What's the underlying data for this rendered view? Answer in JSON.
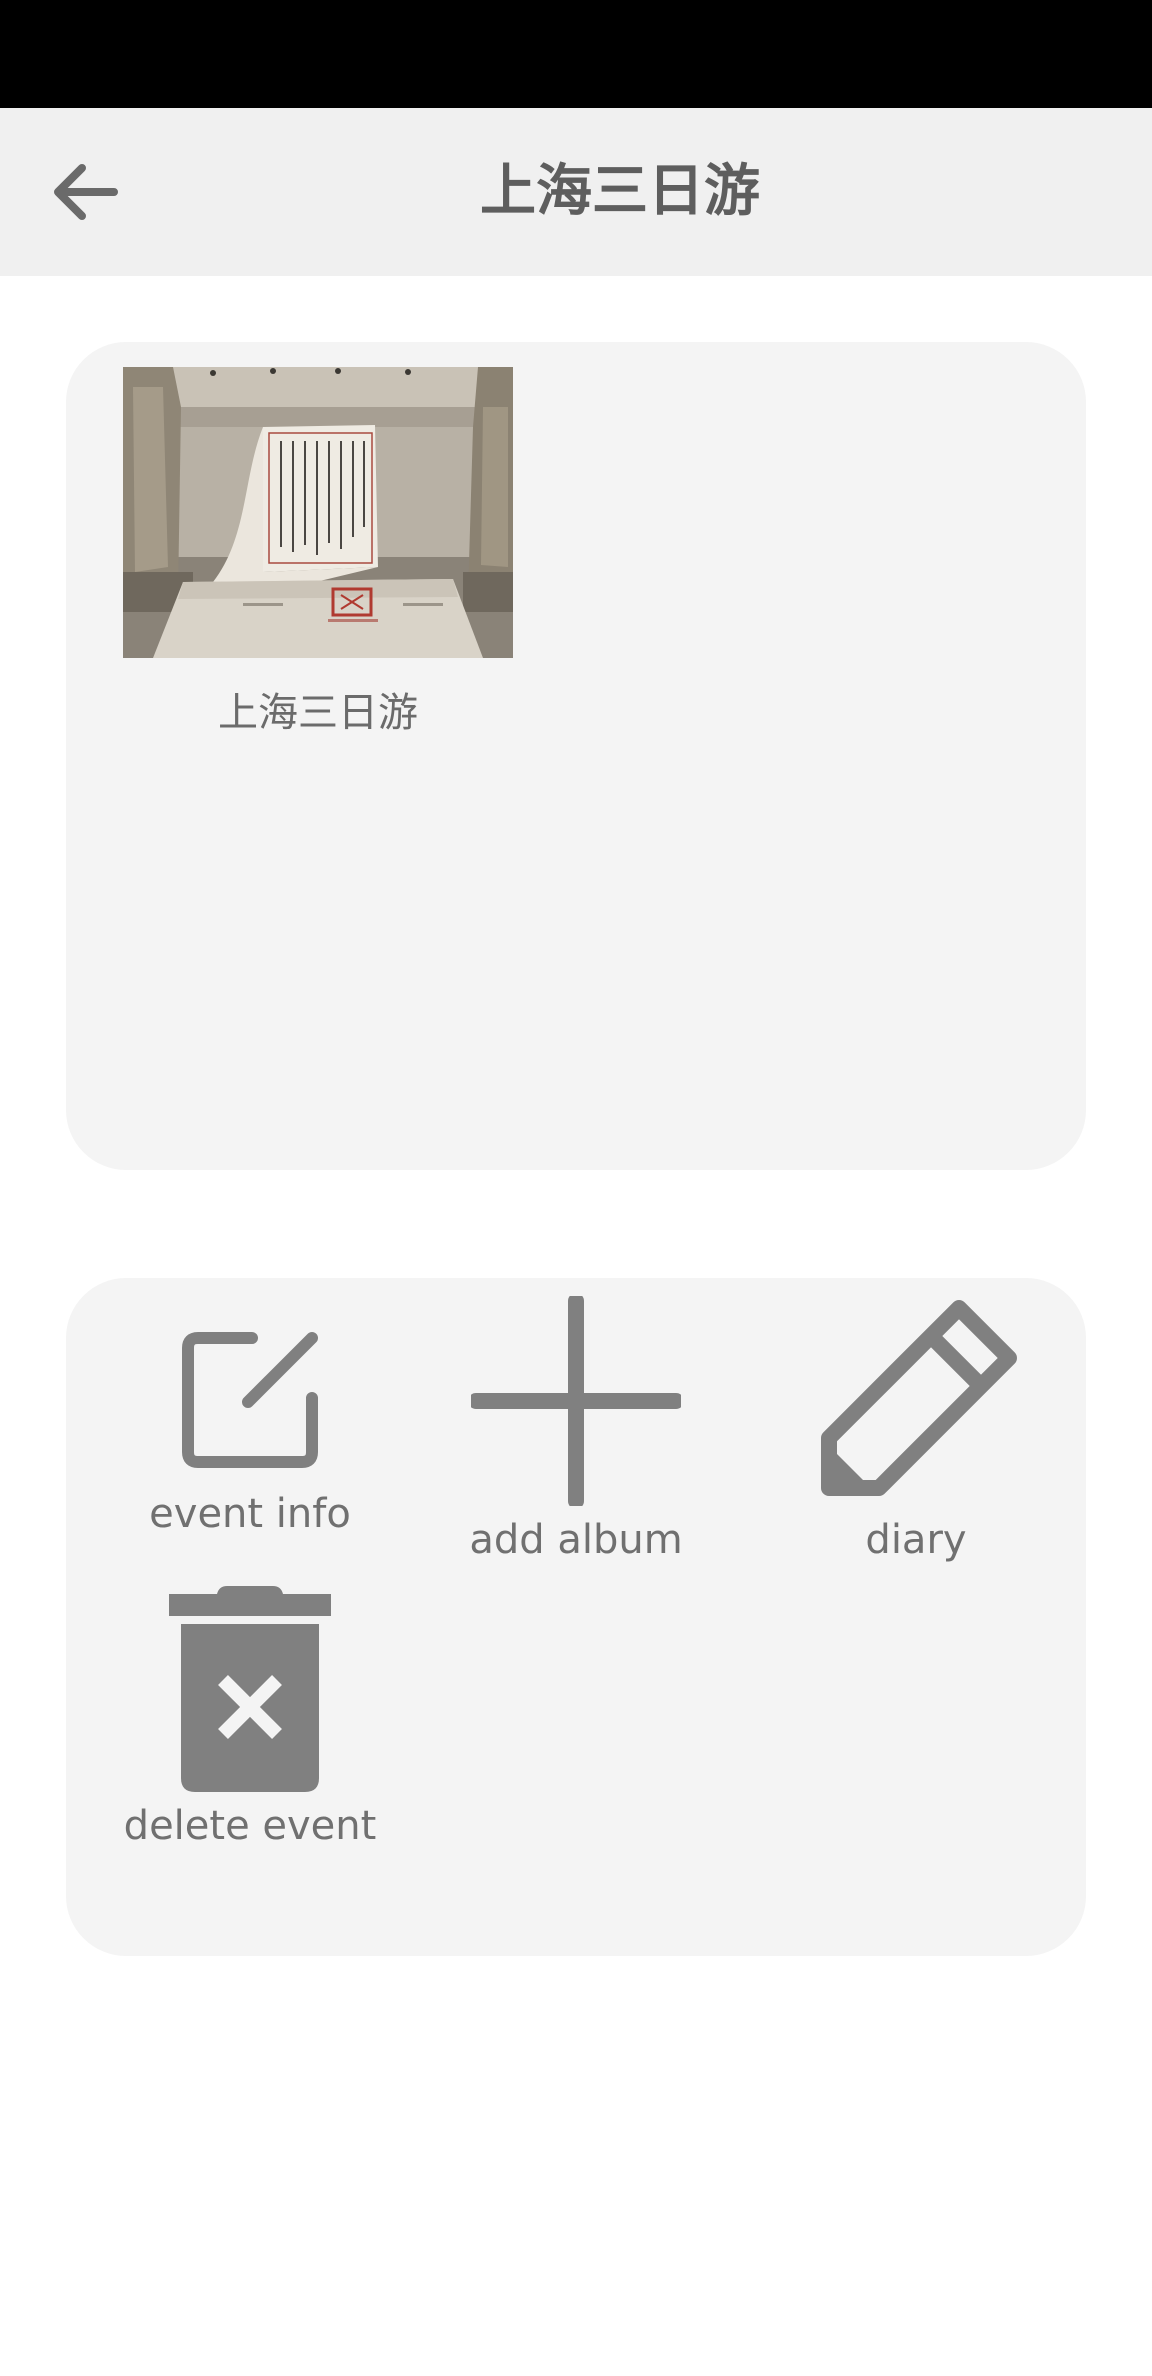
{
  "header": {
    "back_icon": "arrow-left-icon",
    "title": "上海三日游"
  },
  "albums": [
    {
      "name": "上海三日游",
      "thumbnail": "museum-scroll-photo"
    }
  ],
  "actions": [
    {
      "label": "event info",
      "icon": "edit-square-icon"
    },
    {
      "label": "add album",
      "icon": "plus-icon"
    },
    {
      "label": "diary",
      "icon": "pencil-icon"
    },
    {
      "label": "delete event",
      "icon": "trash-x-icon"
    }
  ],
  "colors": {
    "header_bg": "#f0f0f0",
    "panel_bg": "#f4f4f4",
    "icon": "#808080",
    "text": "#6f6f6f"
  }
}
